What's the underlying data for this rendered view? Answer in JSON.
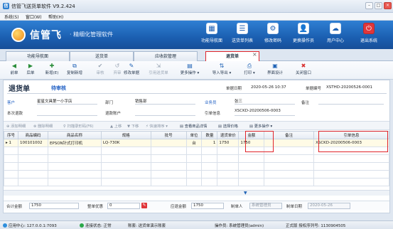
{
  "window": {
    "title": "信管飞送货单软件 V9.2.424",
    "min": "–",
    "max": "□",
    "close": "×"
  },
  "menu": [
    "系统(S)",
    "窗口(W)",
    "帮助(H)"
  ],
  "brand": {
    "name": "信管飞",
    "tagline": "· 精细化管理软件"
  },
  "nav": [
    {
      "label": "功能导航面",
      "icon": "▦"
    },
    {
      "label": "送货单列表",
      "icon": "☰"
    },
    {
      "label": "修改密码",
      "icon": "⚙"
    },
    {
      "label": "更换操作员",
      "icon": "👤"
    },
    {
      "label": "用户中心",
      "icon": "☁"
    },
    {
      "label": "退出系统",
      "icon": "⏻"
    }
  ],
  "tabs": [
    "功能导航面",
    "送货单",
    "应收款管理",
    "退货单"
  ],
  "tab_close": "×",
  "toolbar": [
    {
      "label": "前单",
      "icon": "◀",
      "enabled": true
    },
    {
      "label": "后单",
      "icon": "▶",
      "enabled": true
    },
    {
      "label": "新增(E)",
      "icon": "✚",
      "enabled": true
    },
    {
      "label": "复制新增",
      "icon": "⧉",
      "enabled": true
    },
    {
      "label": "审核",
      "icon": "✔",
      "enabled": false
    },
    {
      "label": "弃审",
      "icon": "↺",
      "enabled": false
    },
    {
      "label": "修改单据",
      "icon": "✎",
      "enabled": true
    },
    {
      "label": "引用送货单",
      "icon": "⇲",
      "enabled": false
    },
    {
      "label": "更多操作 ▾",
      "icon": "▤",
      "enabled": true
    },
    {
      "label": "导入导出 ▾",
      "icon": "⇅",
      "enabled": true
    },
    {
      "label": "打印 ▾",
      "icon": "⎙",
      "enabled": true
    },
    {
      "label": "界面设计",
      "icon": "▣",
      "enabled": true
    },
    {
      "label": "关闭窗口",
      "icon": "✖",
      "enabled": true
    }
  ],
  "doc": {
    "title": "退货单",
    "status": "待审核",
    "date_label": "单据日期",
    "date": "2020-05-26 10:37",
    "no_label": "单据编号",
    "no": "XSTHD-20200526-0001",
    "customer_label": "客户",
    "customer": "星星文具第一小字店",
    "dept_label": "部门",
    "dept": "销售部",
    "staff_label": "业务员",
    "staff": "张三",
    "remark_label": "备注",
    "remark": "",
    "refund_label": "本次退款",
    "refund": "",
    "account_label": "退款账户",
    "account": "",
    "ref_label": "引单信息",
    "ref": "XSCKD-20200506-0003"
  },
  "filterbar": [
    {
      "label": "⊕ 添加明细",
      "on": false
    },
    {
      "label": "⊗ 删除明细",
      "on": false
    },
    {
      "label": "⚲ 扫描录形码(F6)",
      "on": false
    },
    {
      "label": "▲ 上移",
      "on": false
    },
    {
      "label": "▼ 下移",
      "on": false
    },
    {
      "label": "⚡ 快速排序 ▾",
      "on": false
    },
    {
      "label": "▤ 查看商品详情",
      "on": true
    },
    {
      "label": "▤ 选择价格",
      "on": true
    },
    {
      "label": "▤ 更多操作 ▾",
      "on": true
    }
  ],
  "table": {
    "headers": [
      "序号",
      "商品编码",
      "商品名称",
      "规格",
      "批号",
      "单位",
      "数量",
      "退货单价",
      "金额",
      "备注",
      "引单信息"
    ],
    "rows": [
      [
        "1",
        "100101002",
        "EPSON针式打印机",
        "LQ-730K",
        "",
        "台",
        "1",
        "1750",
        "1750",
        "",
        "XSCKD-20200506-0003"
      ]
    ],
    "row_marker": "▸"
  },
  "totals_marker": "▼",
  "footer": {
    "total_label": "合计金额",
    "total": "1750",
    "discount_label": "整单优惠",
    "discount": "0",
    "receivable_label": "应退金额",
    "receivable": "1750",
    "maker_label": "制单人",
    "maker": "系统管理员",
    "make_date_label": "制单日期",
    "make_date": "2020-05-26"
  },
  "status": {
    "server": "应用中心: 127.0.0.1:7093",
    "conn": "连接状态: 正常",
    "book": "账套: 送货单演示账套",
    "operator": "操作员: 系统管理员(admin)",
    "license": "正式版 授权序列号: 1130904505"
  },
  "colors": {
    "banner": "#1b5fb1",
    "highlight": "#e0242a",
    "accent": "#1f5fc4"
  }
}
